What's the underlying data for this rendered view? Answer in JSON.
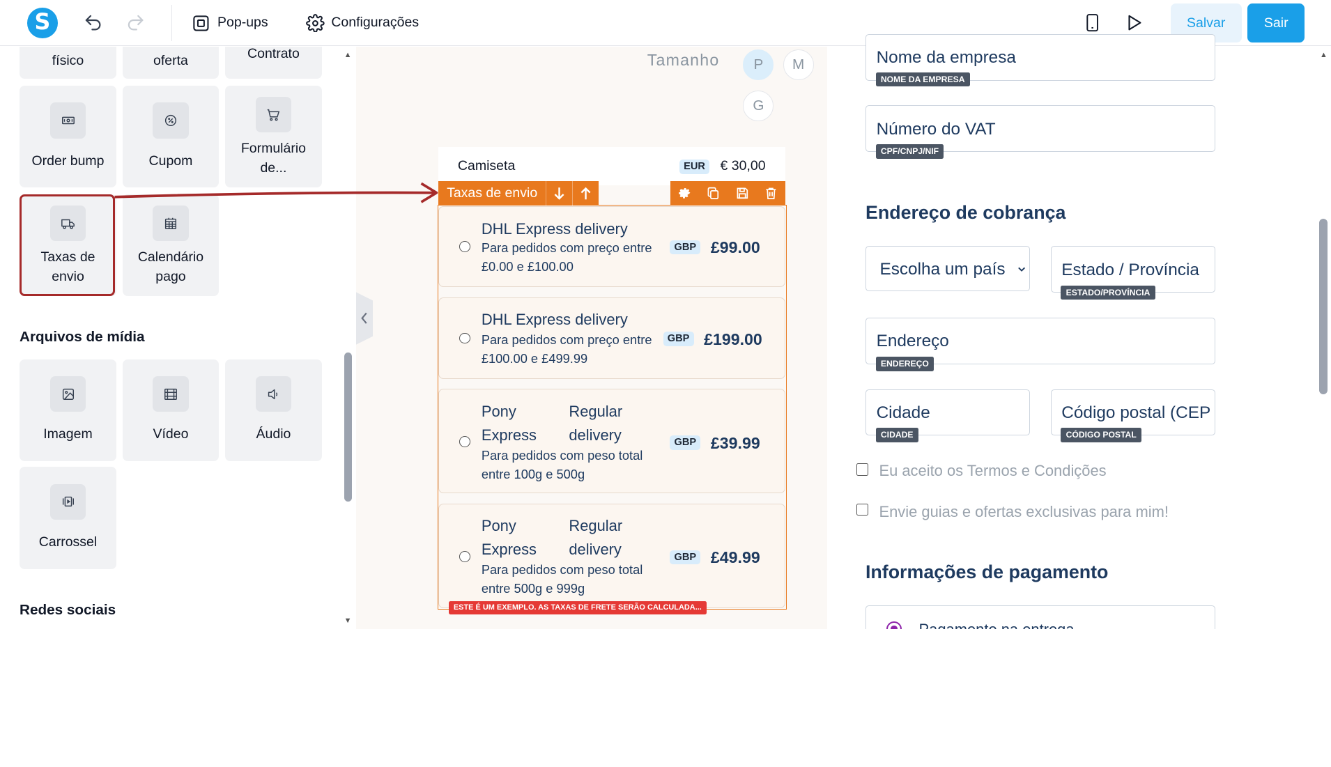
{
  "topbar": {
    "logo": "S",
    "undo_icon": "undo-icon",
    "redo_icon": "redo-icon",
    "popups_label": "Pop-ups",
    "settings_label": "Configurações",
    "save_label": "Salvar",
    "exit_label": "Sair"
  },
  "sidebar": {
    "tiles_top": [
      {
        "label": "físico"
      },
      {
        "label": "oferta"
      },
      {
        "label": "Contrato"
      }
    ],
    "tiles_row2": [
      {
        "label": "Order bump",
        "icon": "ticket-icon"
      },
      {
        "label": "Cupom",
        "icon": "coupon-icon"
      },
      {
        "label": "Formulário de...",
        "icon": "cart-icon"
      }
    ],
    "tiles_row3": [
      {
        "label": "Taxas de envio",
        "icon": "truck-icon"
      },
      {
        "label": "Calendário pago",
        "icon": "calendar-icon"
      }
    ],
    "media_title": "Arquivos de mídia",
    "media_tiles": [
      {
        "label": "Imagem",
        "icon": "image-icon"
      },
      {
        "label": "Vídeo",
        "icon": "film-icon"
      },
      {
        "label": "Áudio",
        "icon": "speaker-icon"
      },
      {
        "label": "Carrossel",
        "icon": "carousel-icon"
      }
    ],
    "social_title": "Redes sociais"
  },
  "canvas": {
    "size_label": "Tamanho",
    "sizes": [
      "P",
      "M",
      "G"
    ],
    "selected_size": "P",
    "product": {
      "name": "Camiseta",
      "currency": "EUR",
      "price": "€ 30,00"
    },
    "block_label": "Taxas de envio",
    "shipping_options": [
      {
        "name": "DHL Express delivery",
        "desc": "Para pedidos com preço entre £0.00 e £100.00",
        "currency": "GBP",
        "amount": "£99.00"
      },
      {
        "name": "DHL Express delivery",
        "desc": "Para pedidos com preço entre £100.00 e £499.99",
        "currency": "GBP",
        "amount": "£199.00"
      },
      {
        "name_a": "Pony Express",
        "name_b": "Regular delivery",
        "desc": "Para pedidos com peso total entre 100g e 500g",
        "currency": "GBP",
        "amount": "£39.99"
      },
      {
        "name_a": "Pony Express",
        "name_b": "Regular delivery",
        "desc": "Para pedidos com peso total entre 500g e 999g",
        "currency": "GBP",
        "amount": "£49.99"
      }
    ],
    "warning": "ESTE É UM EXEMPLO. AS TAXAS DE FRETE SERÃO CALCULADA..."
  },
  "form": {
    "company": {
      "value": "Nome da empresa",
      "tag": "NOME DA EMPRESA"
    },
    "vat": {
      "value": "Número do VAT",
      "tag": "CPF/CNPJ/NIF"
    },
    "billing_title": "Endereço de cobrança",
    "country": {
      "value": "Escolha um país"
    },
    "state": {
      "value": "Estado / Província",
      "tag": "ESTADO/PROVÍNCIA"
    },
    "address": {
      "value": "Endereço",
      "tag": "ENDEREÇO"
    },
    "city": {
      "value": "Cidade",
      "tag": "CIDADE"
    },
    "zip": {
      "value": "Código postal (CEP",
      "tag": "CÓDIGO POSTAL"
    },
    "terms_label": "Eu aceito os Termos e Condições",
    "offers_label": "Envie guias e ofertas exclusivas para mim!",
    "payment_title": "Informações de pagamento",
    "payment_option": "Pagamento na entrega"
  },
  "colors": {
    "brand": "#1a9fe8",
    "block_orange": "#e8791e",
    "highlight_red": "#a52a2a",
    "warning_red": "#e53935",
    "form_text": "#1e3a5f"
  }
}
